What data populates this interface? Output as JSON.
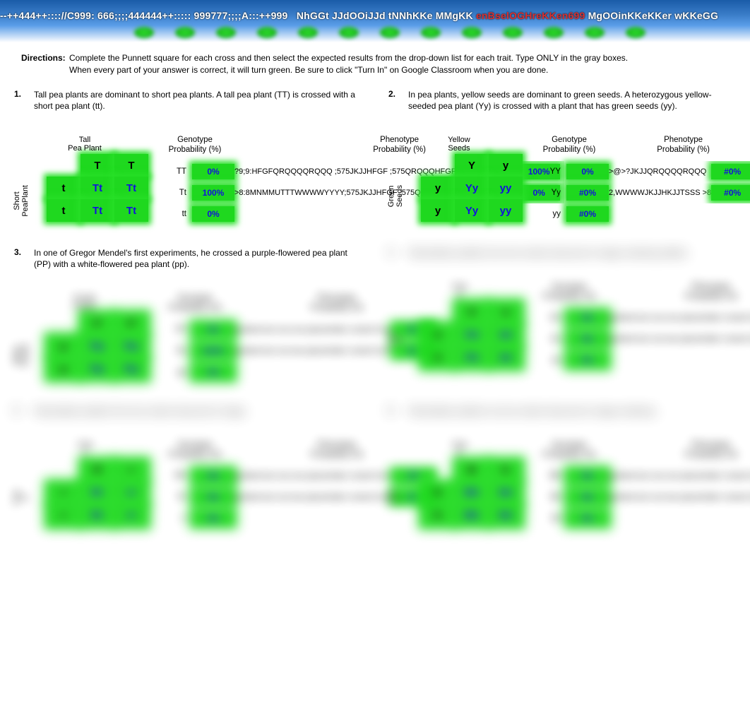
{
  "header": {
    "garble_left": "--++444++:::://",
    "garble_c": "C",
    "garble_mid1": "999: 666;;;;444444++::::: 999777;;;;",
    "garble_a": "A:::",
    "garble_mid2": "++999",
    "garble_mid3": "NhGGt JJdOOiJJd tNNhKKe MMgKK",
    "garble_red": "enBselOGHreKKen699",
    "garble_end": "MgOOinKKeKKer wKKeGG"
  },
  "directions": {
    "label": "Directions:",
    "line1": "Complete the Punnett square for each cross and then select the expected results from the drop-down list for each trait. Type ONLY in the gray boxes.",
    "line2": "When every part of your answer is correct, it will turn green. Be sure to click \"Turn In\" on Google Classroom when you are done."
  },
  "col_heads": {
    "geno": "Genotype\nProbability (%)",
    "pheno": "Phenotype\nProbability (%)"
  },
  "problems": [
    {
      "num": "1.",
      "text": "Tall pea plants are dominant to short pea plants. A tall pea plant (TT) is crossed with a short pea plant (tt).",
      "top_label": "Tall\nPea Plant",
      "side_label": "Short\nPeaPlant",
      "col_alleles": [
        "T",
        "T"
      ],
      "row_alleles": [
        "t",
        "t"
      ],
      "grid": [
        [
          "Tt",
          "Tt"
        ],
        [
          "Tt",
          "Tt"
        ]
      ],
      "geno_rows": [
        {
          "lbl": "TT",
          "pct": "0%"
        },
        {
          "lbl": "Tt",
          "pct": "100%"
        },
        {
          "lbl": "tt",
          "pct": "0%"
        }
      ],
      "pheno_rows": [
        {
          "garble": "?9;9:HFGFQRQQQQRQQQ ;575JKJJHFGF ;575QRQQQHFGFTSSSYYYY$%",
          "pct": "100%"
        },
        {
          "garble": ">8:8MNMMUTTTWWWWYYYY;575JKJJHFGF ;575QRQQQHFGFTSSSYYYY$%",
          "pct": "0%"
        }
      ]
    },
    {
      "num": "2.",
      "text": "In pea plants, yellow seeds are dominant to green seeds. A heterozygous yellow-seeded pea plant (Yy) is crossed with a plant that has green seeds (yy).",
      "top_label": "Yellow\nSeeds",
      "side_label": "Green\nSeeds",
      "col_alleles": [
        "Y",
        "y"
      ],
      "row_alleles": [
        "y",
        "y"
      ],
      "grid": [
        [
          "Yy",
          "yy"
        ],
        [
          "Yy",
          "yy"
        ]
      ],
      "geno_rows": [
        {
          "lbl": "YY",
          "pct": "0%"
        },
        {
          "lbl": "Yy",
          "pct": "#0%"
        },
        {
          "lbl": "yy",
          "pct": "#0%"
        }
      ],
      "pheno_rows": [
        {
          "garble": ">@>?JKJJQRQQQQRQQQ",
          "pct": "#0%"
        },
        {
          "garble": "2,WWWWJKJJHKJJTSSS >8",
          "pct": "#0%"
        }
      ]
    },
    {
      "num": "3.",
      "text": "In one of Gregor Mendel's first experiments, he crossed a purple-flowered pea plant (PP) with a white-flowered pea plant (pp).",
      "top_label": "Purple\nFlower",
      "side_label": "White\nFlower",
      "col_alleles": [
        "P",
        "P"
      ],
      "row_alleles": [
        "p",
        "p"
      ],
      "grid": [
        [
          "Pp",
          "Pp"
        ],
        [
          "Pp",
          "Pp"
        ]
      ],
      "geno_rows": [
        {
          "lbl": "PP",
          "pct": "0%"
        },
        {
          "lbl": "Pp",
          "pct": "100%"
        },
        {
          "lbl": "pp",
          "pct": "0%"
        }
      ],
      "pheno_rows": [
        {
          "garble": "garbled text row one placeholder content here",
          "pct": "0%"
        },
        {
          "garble": "garbled text row two placeholder content here",
          "pct": "0%"
        }
      ]
    },
    {
      "num": "4.",
      "text": "Placeholder problem four text content obscured in image rendering artifact.",
      "top_label": "Trait\nA",
      "side_label": "Trait\nB",
      "col_alleles": [
        "A",
        "a"
      ],
      "row_alleles": [
        "a",
        "a"
      ],
      "grid": [
        [
          "Aa",
          "aa"
        ],
        [
          "Aa",
          "aa"
        ]
      ],
      "geno_rows": [
        {
          "lbl": "AA",
          "pct": "0%"
        },
        {
          "lbl": "Aa",
          "pct": "0%"
        },
        {
          "lbl": "aa",
          "pct": "0%"
        }
      ],
      "pheno_rows": [
        {
          "garble": "garbled text row one placeholder content here",
          "pct": "0%"
        },
        {
          "garble": "garbled text row two placeholder content here",
          "pct": "0%"
        }
      ]
    },
    {
      "num": "5.",
      "text": "Placeholder problem five text content obscured in image.",
      "top_label": "Trait\nC",
      "side_label": "Trait\nD",
      "col_alleles": [
        "R",
        "r"
      ],
      "row_alleles": [
        "r",
        "r"
      ],
      "grid": [
        [
          "Rr",
          "rr"
        ],
        [
          "Rr",
          "rr"
        ]
      ],
      "geno_rows": [
        {
          "lbl": "RR",
          "pct": "0%"
        },
        {
          "lbl": "Rr",
          "pct": "0%"
        },
        {
          "lbl": "rr",
          "pct": "0%"
        }
      ],
      "pheno_rows": [
        {
          "garble": "garbled text row one placeholder content here",
          "pct": "0%"
        },
        {
          "garble": "garbled text row two placeholder content here",
          "pct": "0%"
        }
      ]
    },
    {
      "num": "6.",
      "text": "Placeholder problem six text content obscured in image rendering.",
      "top_label": "Trait\nE",
      "side_label": "Trait\nF",
      "col_alleles": [
        "B",
        "b"
      ],
      "row_alleles": [
        "b",
        "b"
      ],
      "grid": [
        [
          "Bb",
          "bb"
        ],
        [
          "Bb",
          "bb"
        ]
      ],
      "geno_rows": [
        {
          "lbl": "BB",
          "pct": "0%"
        },
        {
          "lbl": "Bb",
          "pct": "0%"
        },
        {
          "lbl": "bb",
          "pct": "0%"
        }
      ],
      "pheno_rows": [
        {
          "garble": "garbled text row one placeholder content here",
          "pct": "0%"
        },
        {
          "garble": "garbled text row two placeholder content here",
          "pct": "0%"
        }
      ]
    }
  ]
}
